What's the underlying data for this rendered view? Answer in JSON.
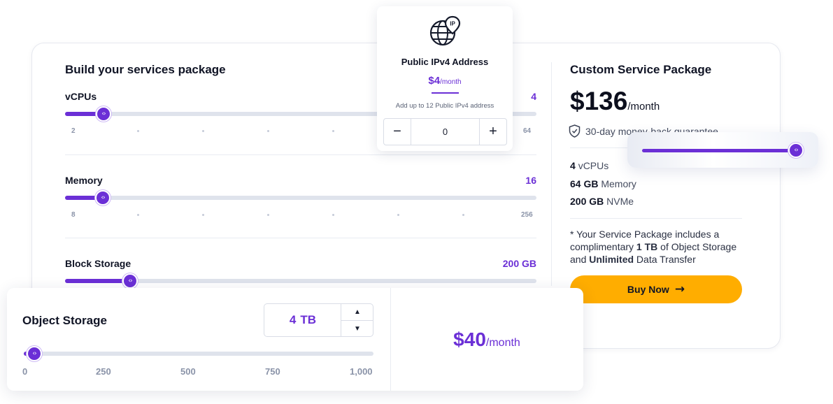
{
  "builder": {
    "title": "Build your services package",
    "sliders": [
      {
        "label": "vCPUs",
        "value": "4",
        "min": "2",
        "max": "64"
      },
      {
        "label": "Memory",
        "value": "16",
        "min": "8",
        "max": "256"
      },
      {
        "label": "Block Storage",
        "value": "200 GB"
      }
    ]
  },
  "ip_addon": {
    "icon": "globe-ip-pin-icon",
    "title": "Public IPv4 Address",
    "price": "$4",
    "price_unit": "/month",
    "description": "Add up to 12 Public IPv4 address",
    "minus": "−",
    "quantity": "0",
    "plus": "+"
  },
  "summary": {
    "title": "Custom Service Package",
    "price": "$136",
    "price_unit": "/month",
    "guarantee": "30-day money-back guarantee",
    "specs": [
      {
        "amount": "4",
        "unit": "vCPUs"
      },
      {
        "amount": "64 GB",
        "unit": "Memory"
      },
      {
        "amount": "200 GB",
        "unit": "NVMe"
      }
    ],
    "note_prefix": "* Your Service Package includes a complimentary ",
    "note_bold1": "1 TB",
    "note_mid": " of Object Storage and ",
    "note_bold2": "Unlimited",
    "note_suffix": " Data Transfer",
    "buy_label": "Buy Now",
    "buy_arrow": "→"
  },
  "object_storage": {
    "label": "Object Storage",
    "amount": "4",
    "unit": "TB",
    "up_arrow": "▲",
    "down_arrow": "▼",
    "ticks": [
      "0",
      "250",
      "500",
      "750",
      "1,000"
    ],
    "price": "$40",
    "price_unit": "/month"
  },
  "colors": {
    "accent": "#6b2fd6",
    "button": "#ffad00",
    "track": "#dfe3ec"
  }
}
